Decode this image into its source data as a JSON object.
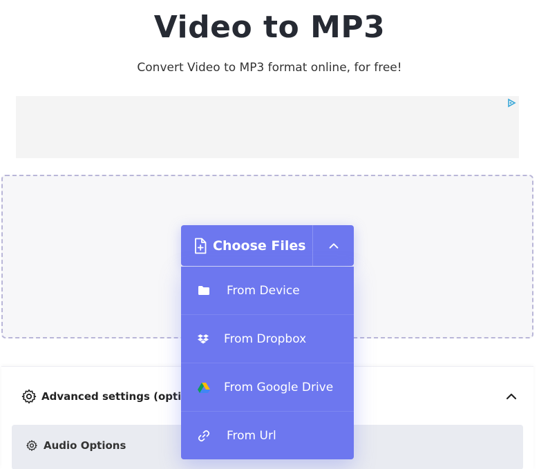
{
  "header": {
    "title": "Video to MP3",
    "subtitle": "Convert Video to MP3 format online, for free!"
  },
  "ad": {
    "icon": "adchoices-icon"
  },
  "upload": {
    "choose_label": "Choose Files",
    "menu": [
      {
        "label": "From Device",
        "icon": "folder-icon"
      },
      {
        "label": "From Dropbox",
        "icon": "dropbox-icon"
      },
      {
        "label": "From Google Drive",
        "icon": "google-drive-icon"
      },
      {
        "label": "From Url",
        "icon": "link-icon"
      }
    ]
  },
  "settings": {
    "title": "Advanced settings (optional)",
    "audio_label": "Audio Options"
  },
  "colors": {
    "accent": "#6d77ef",
    "drop_border": "#b9b6d8",
    "panel_bg": "#e9ebf1"
  }
}
